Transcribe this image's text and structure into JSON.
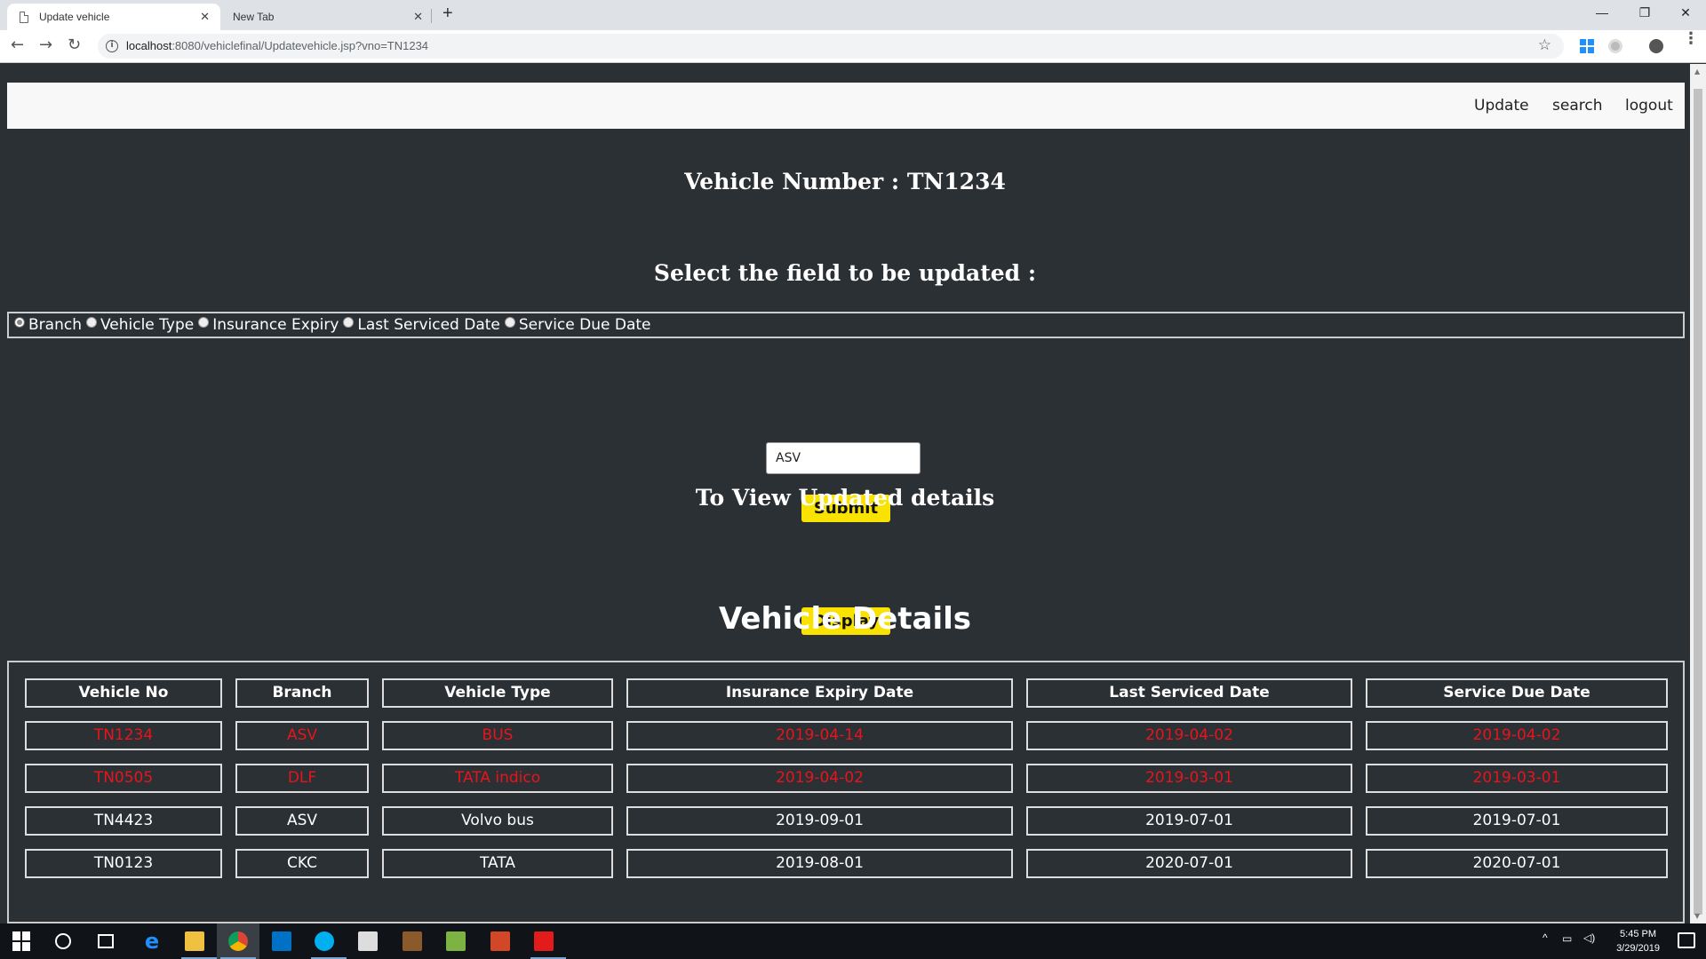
{
  "browser": {
    "tabs": [
      {
        "title": "Update vehicle",
        "active": true
      },
      {
        "title": "New Tab",
        "active": false
      }
    ],
    "url_host": "localhost",
    "url_path": ":8080/vehiclefinal/Updatevehicle.jsp?vno=TN1234"
  },
  "nav": {
    "update": "Update",
    "search": "search",
    "logout": "logout"
  },
  "vehicle_number_heading": "Vehicle Number : TN1234",
  "select_heading": "Select the field to be updated :",
  "radio_options": [
    {
      "label": "Branch",
      "checked": true
    },
    {
      "label": "Vehicle Type",
      "checked": false
    },
    {
      "label": "Insurance Expiry",
      "checked": false
    },
    {
      "label": "Last Serviced Date",
      "checked": false
    },
    {
      "label": "Service Due Date",
      "checked": false
    }
  ],
  "update_input_value": "ASV",
  "submit_label": "Submit",
  "view_heading": "To View Updated details",
  "display_label": "Display",
  "details_heading": "Vehicle Details",
  "table": {
    "headers": [
      "Vehicle No",
      "Branch",
      "Vehicle Type",
      "Insurance Expiry Date",
      "Last Serviced Date",
      "Service Due Date"
    ],
    "rows": [
      {
        "cells": [
          "TN1234",
          "ASV",
          "BUS",
          "2019-04-14",
          "2019-04-02",
          "2019-04-02"
        ],
        "highlight": "red"
      },
      {
        "cells": [
          "TN0505",
          "DLF",
          "TATA indico",
          "2019-04-02",
          "2019-03-01",
          "2019-03-01"
        ],
        "highlight": "red"
      },
      {
        "cells": [
          "TN4423",
          "ASV",
          "Volvo bus",
          "2019-09-01",
          "2019-07-01",
          "2019-07-01"
        ],
        "highlight": "none"
      },
      {
        "cells": [
          "TN0123",
          "CKC",
          "TATA",
          "2019-08-01",
          "2020-07-01",
          "2020-07-01"
        ],
        "highlight": "none"
      }
    ]
  },
  "colors": {
    "page_bg": "#2b3035",
    "button_yellow": "#f9e100",
    "overdue_red": "#e8141b"
  },
  "taskbar": {
    "time": "5:45 PM",
    "date": "3/29/2019"
  }
}
